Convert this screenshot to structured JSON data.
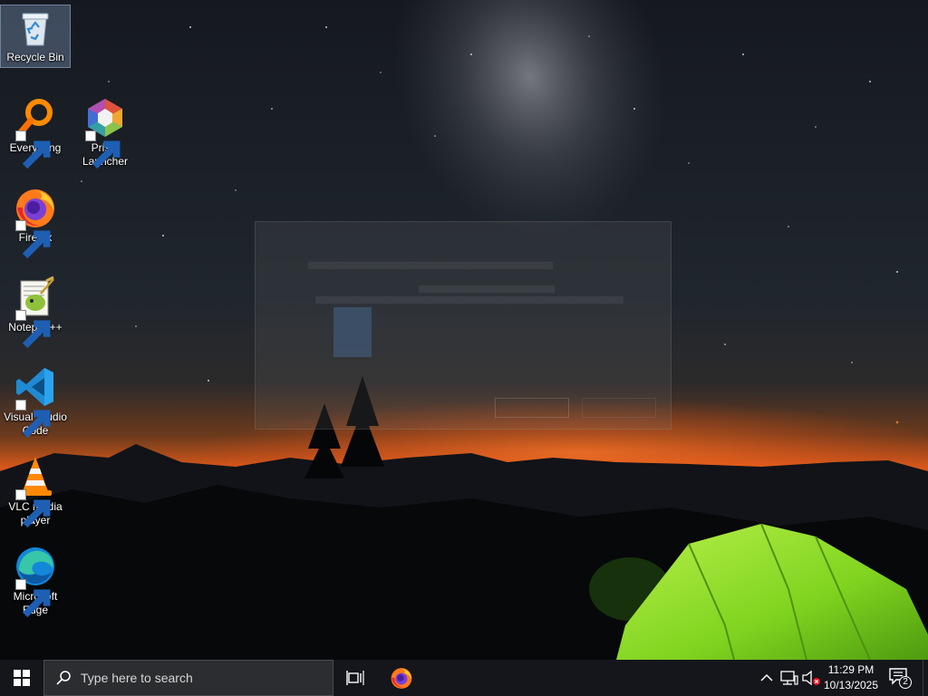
{
  "desktop": {
    "icons": [
      {
        "label": "Recycle Bin",
        "icon": "recycle-bin-icon"
      },
      {
        "label": "Everything",
        "icon": "everything-search-icon"
      },
      {
        "label": "Prism Launcher",
        "icon": "prism-launcher-icon"
      },
      {
        "label": "Firefox",
        "icon": "firefox-icon"
      },
      {
        "label": "Notepad++",
        "icon": "notepad-plus-plus-icon"
      },
      {
        "label": "Visual Studio Code",
        "icon": "vscode-icon"
      },
      {
        "label": "VLC media player",
        "icon": "vlc-icon"
      },
      {
        "label": "Microsoft Edge",
        "icon": "edge-icon"
      }
    ],
    "selected_icon": "Recycle Bin"
  },
  "taskbar": {
    "start_icon": "windows-logo-icon",
    "search_placeholder": "Type here to search",
    "task_view_icon": "task-view-icon",
    "pinned": [
      {
        "name": "Firefox",
        "icon": "firefox-icon"
      }
    ],
    "tray": {
      "chevron_icon": "chevron-up-icon",
      "network_icon": "network-icon",
      "volume_icon": "volume-muted-icon"
    },
    "clock": {
      "time": "11:29 PM",
      "date": "10/13/2025"
    },
    "notifications": {
      "count": "2",
      "icon": "action-center-icon"
    }
  },
  "colors": {
    "taskbar_bg": "#14161b",
    "search_bg": "#2c2d31",
    "tent_green": "#8fe12a",
    "horizon_orange": "#d9581a"
  }
}
